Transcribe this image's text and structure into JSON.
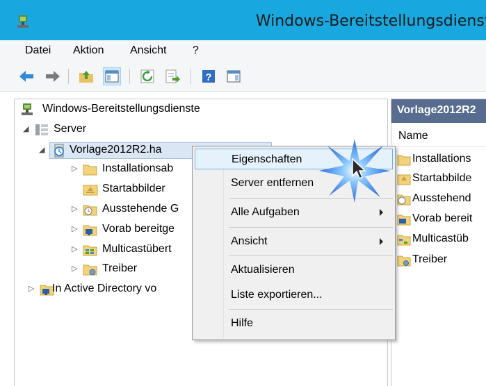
{
  "window": {
    "title": "Windows-Bereitstellungsdienste",
    "app_icon": "wds-server-icon"
  },
  "menubar": {
    "items": [
      "Datei",
      "Aktion",
      "Ansicht",
      "?"
    ]
  },
  "toolbar": {
    "buttons": [
      "back-arrow-icon",
      "forward-arrow-icon",
      "up-folder-icon",
      "show-hide-console-tree-icon",
      "refresh-icon",
      "export-list-icon",
      "help-icon",
      "properties-pane-icon"
    ]
  },
  "tree": {
    "root": "Windows-Bereitstellungsdienste",
    "servers_label": "Server",
    "server_name": "Vorlage2012R2.ha",
    "children": [
      "Installationsab",
      "Startabbilder",
      "Ausstehende G",
      "Vorab bereitge",
      "Multicastübert",
      "Treiber"
    ],
    "active_directory": "In Active Directory vo"
  },
  "right_pane": {
    "header": "Vorlage2012R2",
    "column": "Name",
    "items": [
      "Installations",
      "Startabbilde",
      "Ausstehend",
      "Vorab bereit",
      "Multicastüb",
      "Treiber"
    ]
  },
  "context_menu": {
    "items": [
      {
        "label": "Eigenschaften",
        "highlighted": true
      },
      {
        "label": "Server entfernen"
      },
      {
        "label": "Alle Aufgaben",
        "submenu": true
      },
      {
        "label": "Ansicht",
        "submenu": true
      },
      {
        "label": "Aktualisieren"
      },
      {
        "label": "Liste exportieren..."
      },
      {
        "label": "Hilfe"
      }
    ]
  },
  "colors": {
    "titlebar": "#18a7df",
    "pane_header": "#576c8f",
    "menu_highlight": "#e5f1fb",
    "menu_highlight_border": "#6ab0e8"
  }
}
